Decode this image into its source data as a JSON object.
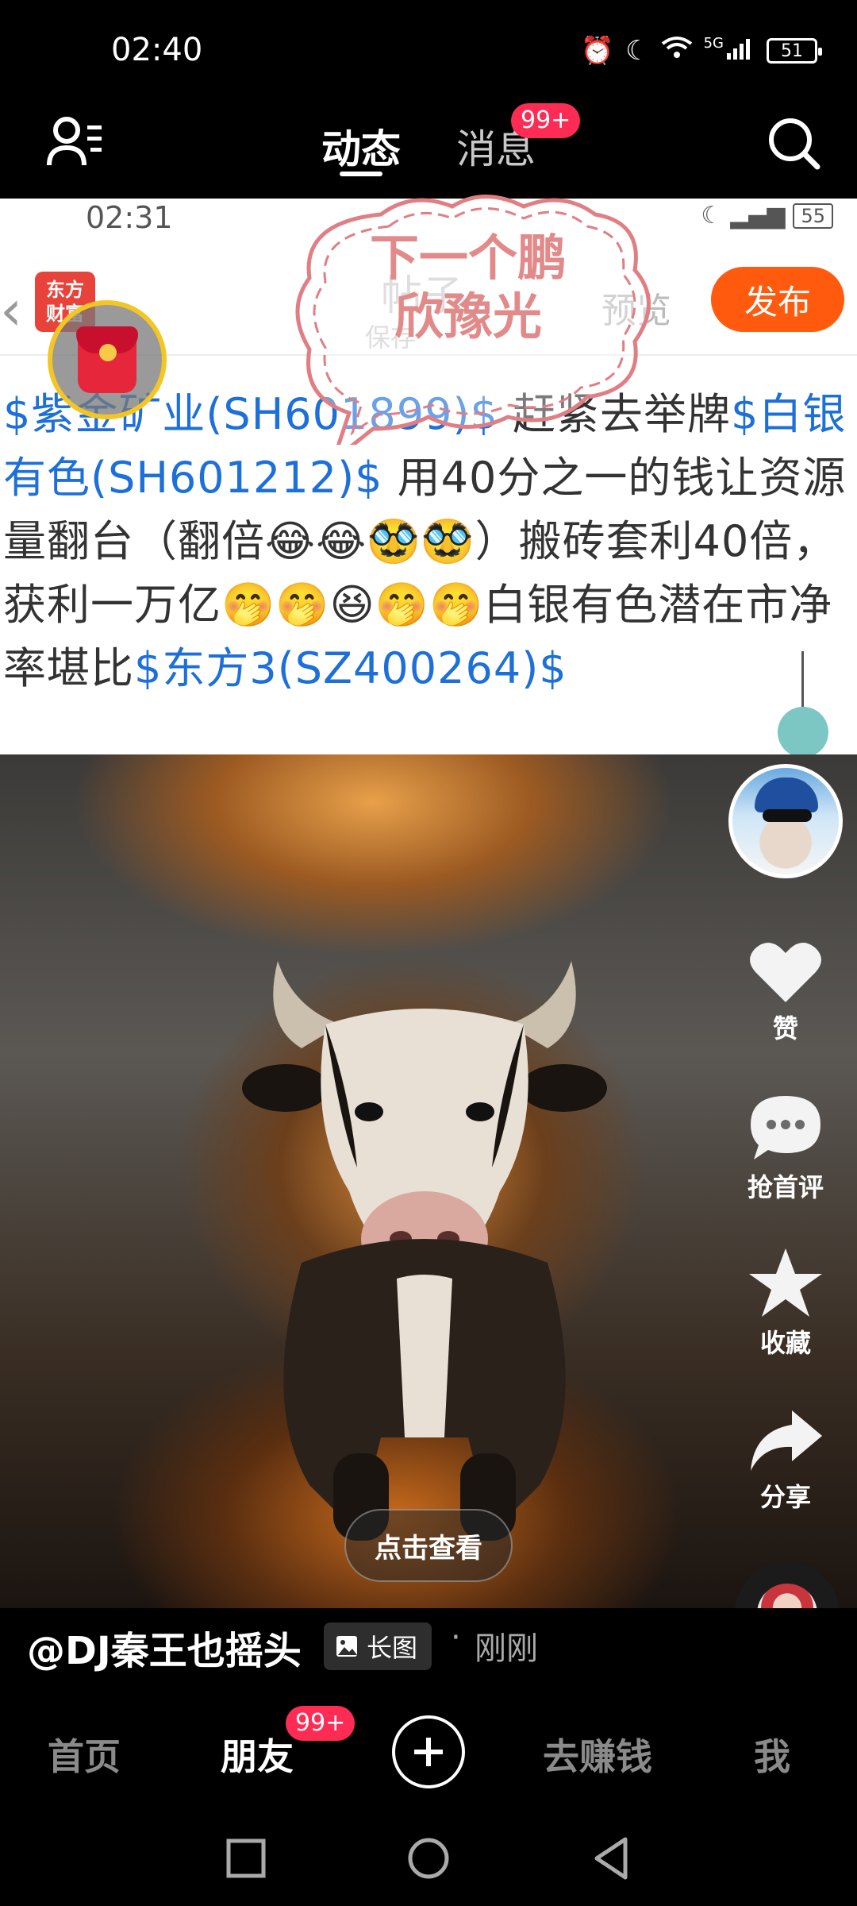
{
  "status_bar": {
    "time": "02:40",
    "network": "5G",
    "battery": "51"
  },
  "top_nav": {
    "tab_active": "动态",
    "tab_messages": "消息",
    "messages_badge": "99+"
  },
  "post_screenshot": {
    "inner_time": "02:31",
    "inner_battery": "55",
    "logo_text": "东方\n财富",
    "tab_post": "帖子",
    "tab_save": "保存",
    "tab_preview": "预览",
    "publish_label": "发布",
    "text_parts": {
      "tag1": "$紫金矿业(SH601899)$",
      "seg1": " 赶紧去举牌",
      "tag2": "$白银有色(SH601212)$",
      "seg2": " 用40分之一的钱让资源量翻台（翻倍😂😂🥸🥸）搬砖套利40倍，获利一万亿🤭🤭😆🤭🤭白银有色潜在市净率堪比",
      "tag3": "$东方3(SZ400264)$"
    }
  },
  "bubble": {
    "line1": "下一个鹏",
    "line2": "欣豫光"
  },
  "media": {
    "view_button": "点击查看"
  },
  "actions": {
    "like": "赞",
    "comment": "抢首评",
    "favorite": "收藏",
    "share": "分享"
  },
  "author": {
    "name": "@DJ秦王也摇头",
    "badge": "长图",
    "separator": "·",
    "time": "刚刚"
  },
  "bottom_tabs": {
    "home": "首页",
    "friends": "朋友",
    "friends_badge": "99+",
    "earn": "去赚钱",
    "me": "我"
  }
}
